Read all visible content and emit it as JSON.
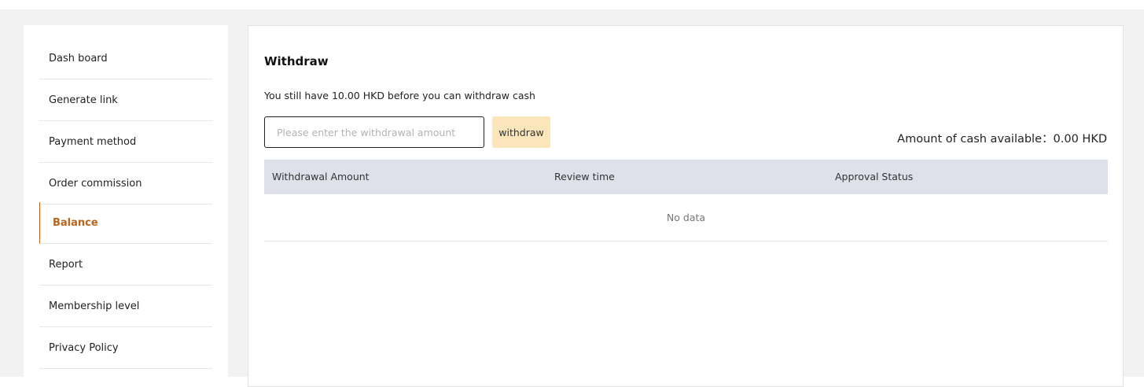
{
  "sidebar": {
    "items": [
      {
        "label": "Dash board",
        "active": false
      },
      {
        "label": "Generate link",
        "active": false
      },
      {
        "label": "Payment method",
        "active": false
      },
      {
        "label": "Order commission",
        "active": false
      },
      {
        "label": "Balance",
        "active": true
      },
      {
        "label": "Report",
        "active": false
      },
      {
        "label": "Membership level",
        "active": false
      },
      {
        "label": "Privacy Policy",
        "active": false
      }
    ]
  },
  "main": {
    "title": "Withdraw",
    "notice": "You still have 10.00 HKD before you can withdraw cash",
    "amount_input": {
      "placeholder": "Please enter the withdrawal amount",
      "value": ""
    },
    "withdraw_button_label": "withdraw",
    "cash_available_label": "Amount of cash available：",
    "cash_available_value": "0.00 HKD",
    "table": {
      "columns": [
        "Withdrawal Amount",
        "Review time",
        "Approval Status"
      ],
      "rows": [],
      "empty_text": "No data"
    }
  },
  "colors": {
    "accent": "#b8651f",
    "button_bg": "#fbe6bb",
    "table_header_bg": "#dfe1ea",
    "page_bg": "#f2f2f2"
  }
}
